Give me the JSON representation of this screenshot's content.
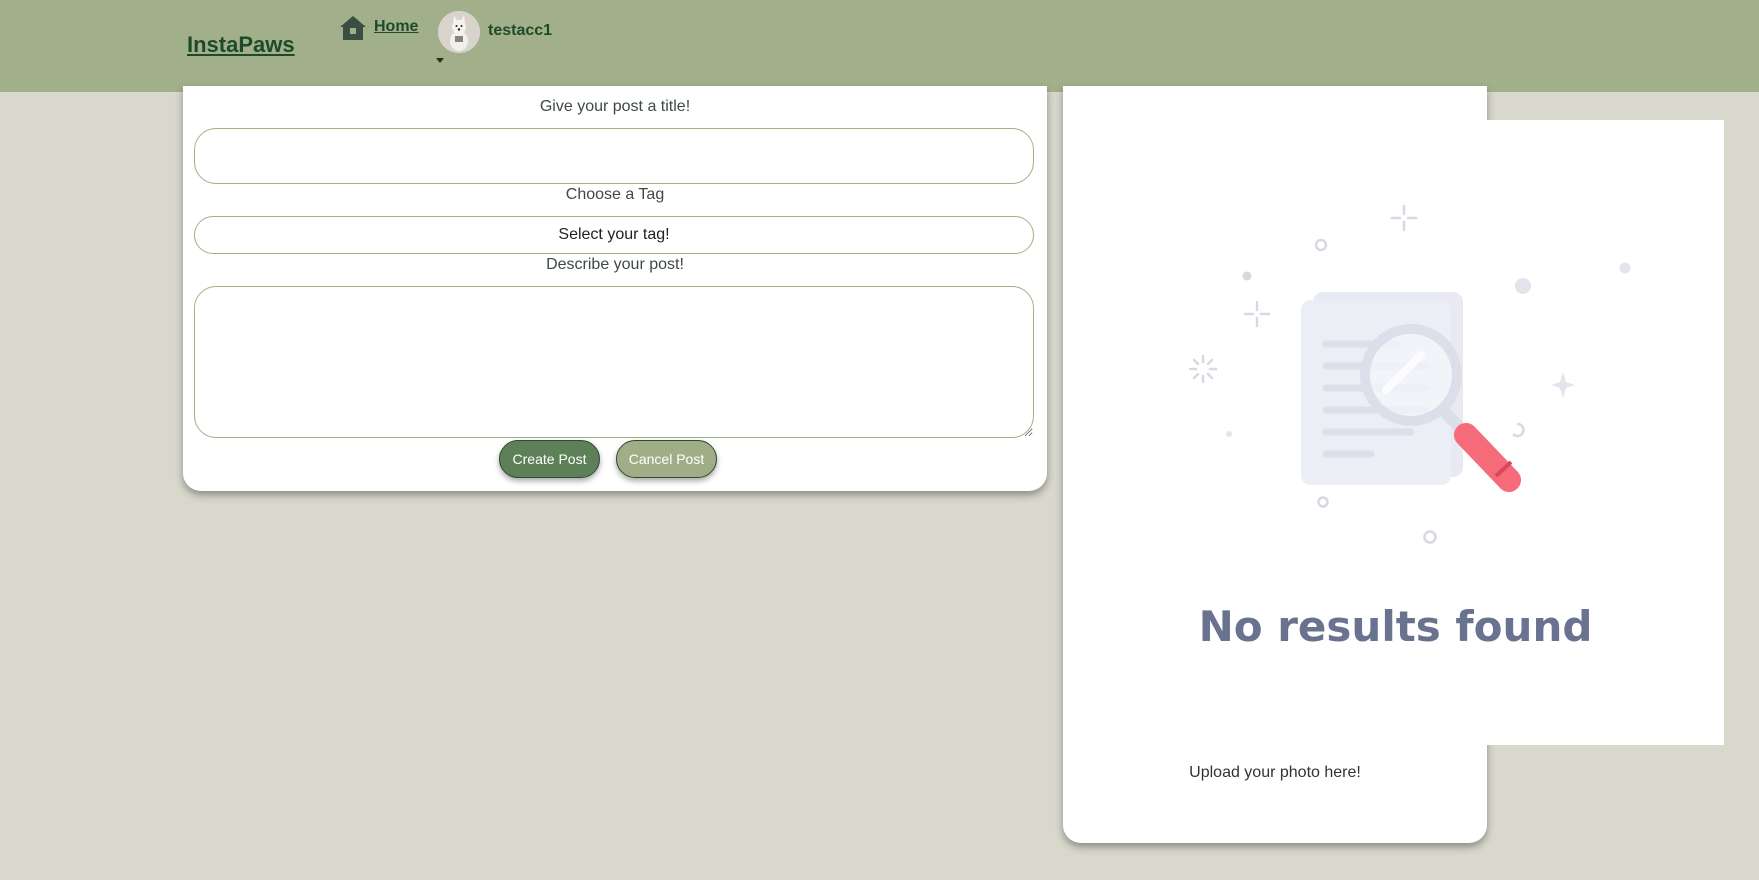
{
  "navbar": {
    "brand": "InstaPaws",
    "home_label": "Home",
    "username": "testacc1"
  },
  "post_form": {
    "title_label": "Give your post a title!",
    "title_value": "",
    "tag_label": "Choose a Tag",
    "tag_selected": "Select your tag!",
    "description_label": "Describe your post!",
    "description_value": "",
    "create_button": "Create Post",
    "cancel_button": "Cancel Post"
  },
  "upload": {
    "empty_state_text": "No results found",
    "upload_label": "Upload your photo here!"
  },
  "colors": {
    "navbar": "#a1b08a",
    "background": "#d9d8cc",
    "brand_text": "#1f4a2a",
    "create_button": "#5d8058",
    "cancel_button": "#9fae87",
    "empty_state_text": "#69728f",
    "magnifier_handle": "#f56b7a"
  }
}
